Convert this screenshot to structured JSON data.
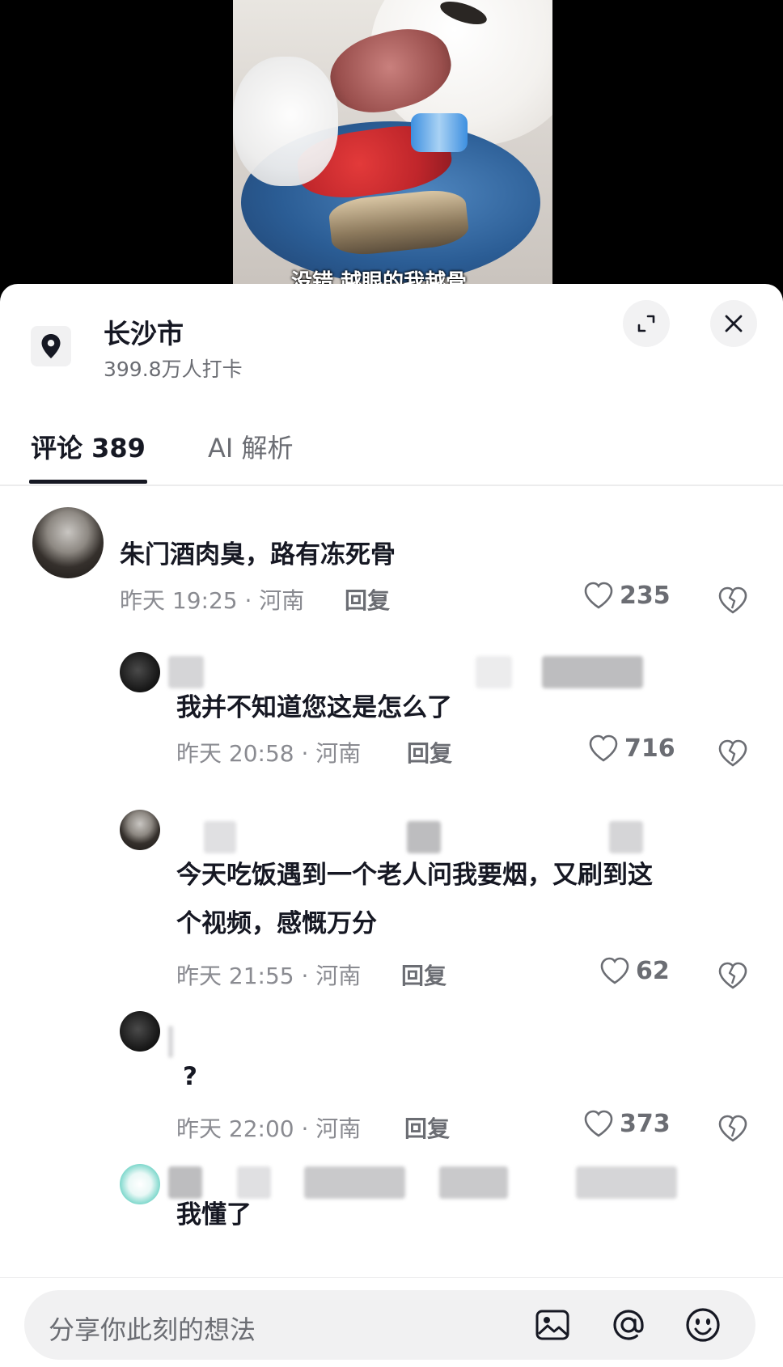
{
  "video": {
    "subtitle": "没错 越眼的我越骨"
  },
  "location": {
    "title": "长沙市",
    "subtitle": "399.8万人打卡",
    "icon": "location-pin-icon"
  },
  "header_buttons": {
    "expand_icon": "expand-icon",
    "close_icon": "close-icon"
  },
  "tabs": [
    {
      "label": "评论 389",
      "active": true
    },
    {
      "label": "AI 解析",
      "active": false
    }
  ],
  "comments": [
    {
      "text": "朱门酒肉臭，路有冻死骨",
      "meta": "昨天 19:25 · 河南",
      "reply": "回复",
      "likes": "235"
    },
    {
      "text": "我并不知道您这是怎么了",
      "meta": "昨天 20:58 · 河南",
      "reply": "回复",
      "likes": "716"
    },
    {
      "text_line1": "今天吃饭遇到一个老人问我要烟，又刷到这",
      "text_line2": "个视频，感慨万分",
      "meta": "昨天 21:55 · 河南",
      "reply": "回复",
      "likes": "62"
    },
    {
      "text": "?",
      "meta": "昨天 22:00 · 河南",
      "reply": "回复",
      "likes": "373"
    },
    {
      "text": "我懂了"
    }
  ],
  "input": {
    "placeholder": "分享你此刻的想法",
    "icons": [
      "image-icon",
      "at-icon",
      "emoji-icon"
    ]
  },
  "colors": {
    "text_primary": "#161823",
    "text_secondary": "#8a8b91",
    "sheet_bg": "#ffffff",
    "input_bg": "#f1f1f2"
  }
}
